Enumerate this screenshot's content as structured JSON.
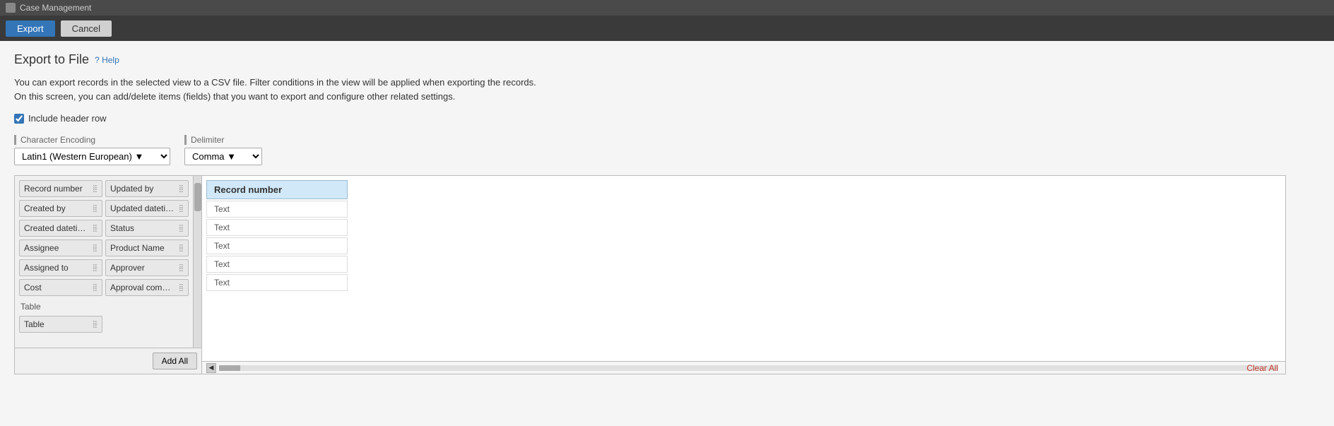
{
  "titleBar": {
    "appIcon": "case-icon",
    "appName": "Case Management"
  },
  "toolbar": {
    "exportLabel": "Export",
    "cancelLabel": "Cancel"
  },
  "page": {
    "title": "Export to File",
    "helpLabel": "Help",
    "description1": "You can export records in the selected view to a CSV file. Filter conditions in the view will be applied when exporting the records.",
    "description2": "On this screen, you can add/delete items (fields) that you want to export and configure other related settings.",
    "includeHeaderLabel": "Include header row",
    "characterEncodingLabel": "Character Encoding",
    "characterEncodingValue": "Latin1 (Western European)",
    "delimiterLabel": "Delimiter",
    "delimiterValue": "Comma"
  },
  "fields": {
    "items": [
      {
        "label": "Record number",
        "col": 0
      },
      {
        "label": "Updated by",
        "col": 1
      },
      {
        "label": "Created by",
        "col": 0
      },
      {
        "label": "Updated dateti…",
        "col": 1
      },
      {
        "label": "Created dateti…",
        "col": 0
      },
      {
        "label": "Status",
        "col": 1
      },
      {
        "label": "Assignee",
        "col": 0
      },
      {
        "label": "Product Name",
        "col": 1
      },
      {
        "label": "Assigned to",
        "col": 0
      },
      {
        "label": "Approver",
        "col": 1
      },
      {
        "label": "Cost",
        "col": 0
      },
      {
        "label": "Approval com…",
        "col": 1
      }
    ],
    "sectionLabel": "Table",
    "sectionItems": [
      {
        "label": "Table",
        "col": 0
      }
    ]
  },
  "exportColumns": {
    "header": "Record number",
    "rows": [
      "Text",
      "Text",
      "Text",
      "Text",
      "Text"
    ]
  },
  "buttons": {
    "addAllLabel": "Add All",
    "clearAllLabel": "Clear All"
  }
}
